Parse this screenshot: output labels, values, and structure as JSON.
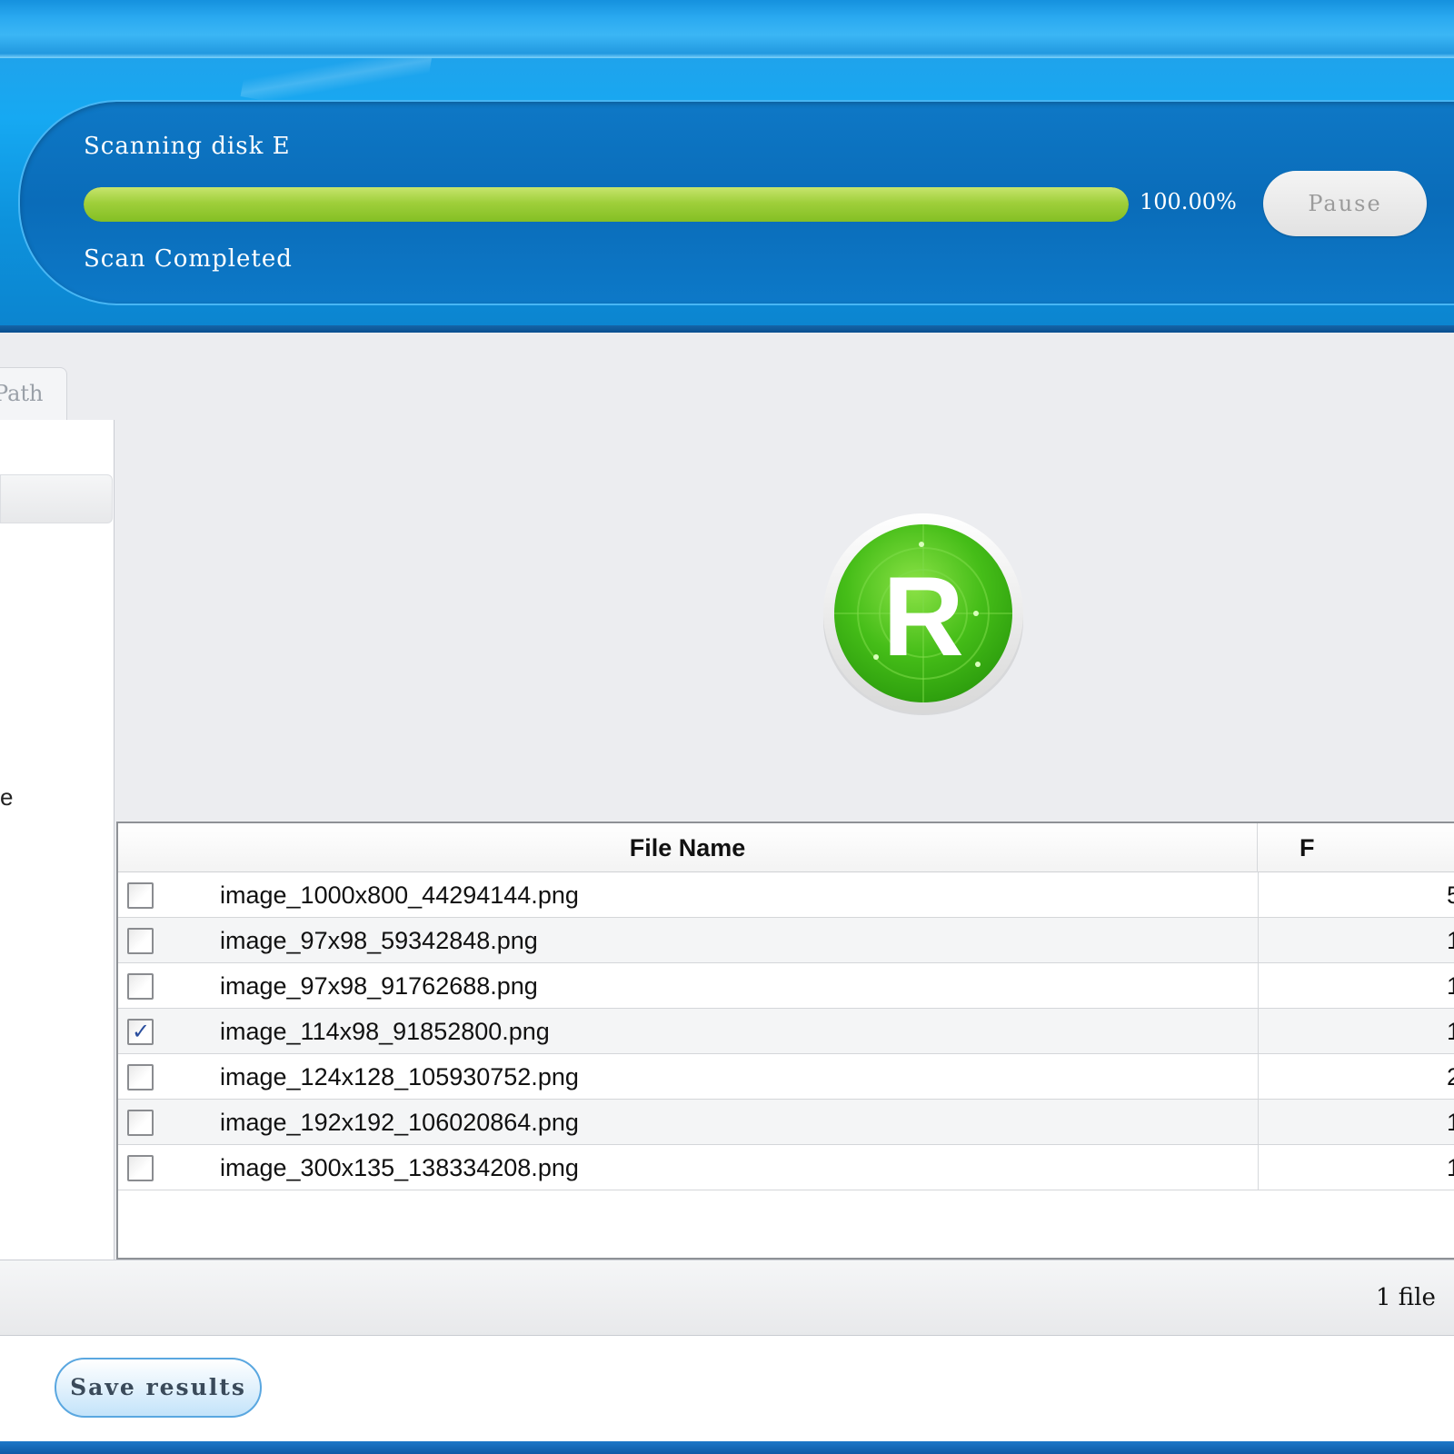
{
  "scan": {
    "title": "Scanning disk E",
    "progress_percent": 100,
    "progress_text": "100.00%",
    "pause_label": "Pause",
    "status": "Scan Completed"
  },
  "left_panel": {
    "tab_label": "Path",
    "partial_item_text": "e"
  },
  "table": {
    "headers": {
      "file_name": "File Name",
      "second_partial": "F"
    },
    "rows": [
      {
        "checked": false,
        "file_name": "image_1000x800_44294144.png",
        "size_partial": "5"
      },
      {
        "checked": false,
        "file_name": "image_97x98_59342848.png",
        "size_partial": "1"
      },
      {
        "checked": false,
        "file_name": "image_97x98_91762688.png",
        "size_partial": "1"
      },
      {
        "checked": true,
        "file_name": "image_114x98_91852800.png",
        "size_partial": "1"
      },
      {
        "checked": false,
        "file_name": "image_124x128_105930752.png",
        "size_partial": "2"
      },
      {
        "checked": false,
        "file_name": "image_192x192_106020864.png",
        "size_partial": "1"
      },
      {
        "checked": false,
        "file_name": "image_300x135_138334208.png",
        "size_partial": "1"
      }
    ]
  },
  "status_bar": {
    "selected_text": "1 file"
  },
  "footer": {
    "save_label": "Save results"
  },
  "icons": {
    "logo": "recovery-radar-r-logo-icon",
    "checkbox": "checkbox-icon"
  },
  "colors": {
    "header_blue": "#0c84cf",
    "progress_green": "#9fcf3b",
    "logo_green": "#4cc51c"
  }
}
